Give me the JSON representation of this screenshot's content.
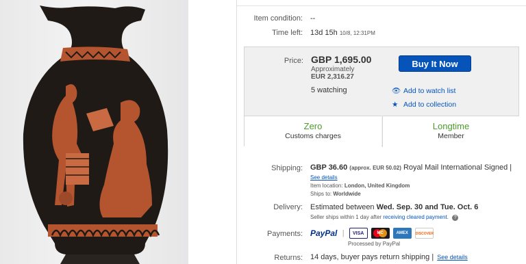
{
  "item": {
    "condition_label": "Item condition:",
    "condition_value": "--",
    "time_label": "Time left:",
    "time_value": "13d 15h",
    "time_end": "10/8, 12:31PM"
  },
  "price": {
    "label": "Price:",
    "value": "GBP 1,695.00",
    "approx_label": "Approximately",
    "approx_value": "EUR 2,316.27",
    "watching": "5 watching",
    "buy_button": "Buy It Now",
    "watch_link": "Add to watch list",
    "collection_link": "Add to collection"
  },
  "features": {
    "left_title": "Zero",
    "left_sub": "Customs charges",
    "right_title": "Longtime",
    "right_sub": "Member"
  },
  "shipping": {
    "label": "Shipping:",
    "cost": "GBP 36.60",
    "approx": "(approx. EUR 50.02)",
    "service": "Royal Mail International Signed |",
    "see_details": "See details",
    "location_label": "Item location:",
    "location_value": "London, United Kingdom",
    "ships_to_label": "Ships to:",
    "ships_to_value": "Worldwide"
  },
  "delivery": {
    "label": "Delivery:",
    "prefix": "Estimated between",
    "dates": "Wed. Sep. 30 and Tue. Oct. 6",
    "note_prefix": "Seller ships within 1 day after",
    "note_link": "receiving cleared payment",
    "note_suffix": "."
  },
  "payments": {
    "label": "Payments:",
    "paypal": "PayPal",
    "cards": [
      "VISA",
      "MC",
      "AMEX",
      "DISCOVER"
    ],
    "processed": "Processed by PayPal"
  },
  "returns": {
    "label": "Returns:",
    "value": "14 days, buyer pays return shipping |",
    "link": "See details"
  },
  "colors": {
    "accent": "#0654ba",
    "green": "#4c9a2a",
    "vase_black": "#1f1a16",
    "terracotta": "#b5552f"
  }
}
